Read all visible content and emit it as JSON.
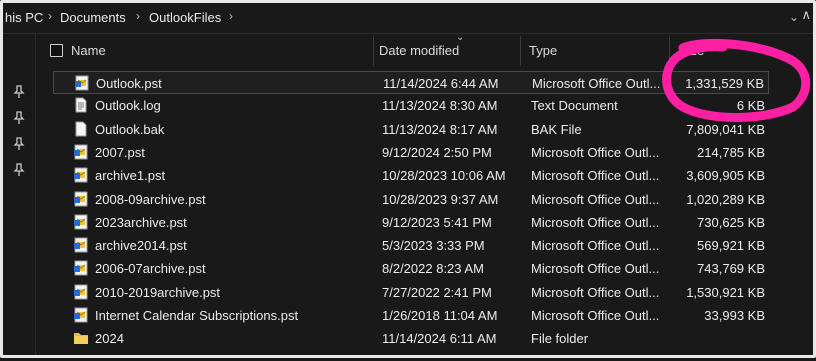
{
  "breadcrumb": {
    "items": [
      "his PC",
      "Documents",
      "OutlookFiles"
    ]
  },
  "columns": {
    "name": "Name",
    "date": "Date modified",
    "type": "Type",
    "size": "Size"
  },
  "files": [
    {
      "name": "Outlook.pst",
      "date": "11/14/2024 6:44 AM",
      "type": "Microsoft Office Outl...",
      "size": "1,331,529 KB",
      "icon": "pst-file-icon"
    },
    {
      "name": "Outlook.log",
      "date": "11/13/2024 8:30 AM",
      "type": "Text Document",
      "size": "6 KB",
      "icon": "text-file-icon"
    },
    {
      "name": "Outlook.bak",
      "date": "11/13/2024 8:17 AM",
      "type": "BAK File",
      "size": "7,809,041 KB",
      "icon": "blank-file-icon"
    },
    {
      "name": "2007.pst",
      "date": "9/12/2024 2:50 PM",
      "type": "Microsoft Office Outl...",
      "size": "214,785 KB",
      "icon": "pst-file-icon"
    },
    {
      "name": "archive1.pst",
      "date": "10/28/2023 10:06 AM",
      "type": "Microsoft Office Outl...",
      "size": "3,609,905 KB",
      "icon": "pst-file-icon"
    },
    {
      "name": "2008-09archive.pst",
      "date": "10/28/2023 9:37 AM",
      "type": "Microsoft Office Outl...",
      "size": "1,020,289 KB",
      "icon": "pst-file-icon"
    },
    {
      "name": "2023archive.pst",
      "date": "9/12/2023 5:41 PM",
      "type": "Microsoft Office Outl...",
      "size": "730,625 KB",
      "icon": "pst-file-icon"
    },
    {
      "name": "archive2014.pst",
      "date": "5/3/2023 3:33 PM",
      "type": "Microsoft Office Outl...",
      "size": "569,921 KB",
      "icon": "pst-file-icon"
    },
    {
      "name": "2006-07archive.pst",
      "date": "8/2/2022 8:23 AM",
      "type": "Microsoft Office Outl...",
      "size": "743,769 KB",
      "icon": "pst-file-icon"
    },
    {
      "name": "2010-2019archive.pst",
      "date": "7/27/2022 2:41 PM",
      "type": "Microsoft Office Outl...",
      "size": "1,530,921 KB",
      "icon": "pst-file-icon"
    },
    {
      "name": "Internet Calendar Subscriptions.pst",
      "date": "1/26/2018 11:04 AM",
      "type": "Microsoft Office Outl...",
      "size": "33,993 KB",
      "icon": "pst-file-icon"
    },
    {
      "name": "2024",
      "date": "11/14/2024 6:11 AM",
      "type": "File folder",
      "size": "",
      "icon": "folder-icon"
    }
  ],
  "colors": {
    "annotation": "#ff1fa3",
    "background": "#191919"
  }
}
